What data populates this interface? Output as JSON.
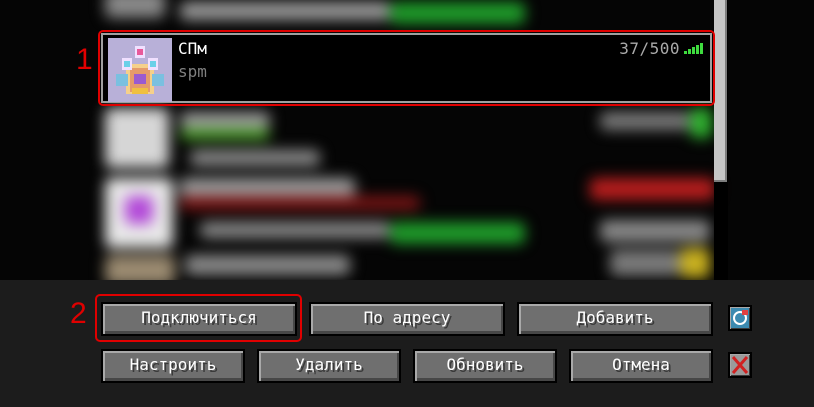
{
  "server": {
    "name": "СПм",
    "motd": "spm",
    "players": "37/500"
  },
  "callouts": {
    "first": "1",
    "second": "2"
  },
  "buttons": {
    "join": "Подключиться",
    "direct": "По адресу",
    "add": "Добавить",
    "edit": "Настроить",
    "delete": "Удалить",
    "refresh": "Обновить",
    "cancel": "Отмена"
  },
  "colors": {
    "callout": "#e00000",
    "signal": "#3fdc3f",
    "button": "#6f6f6f",
    "panel": "#1c1c1c"
  }
}
